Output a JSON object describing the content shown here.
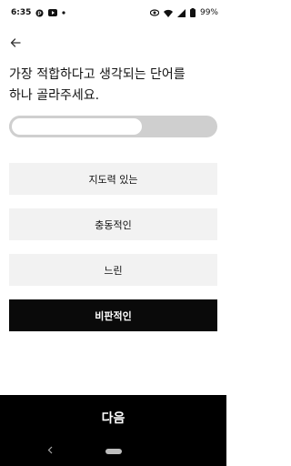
{
  "status_bar": {
    "time": "6:35",
    "battery": "99%",
    "left_icons": [
      "p-app-icon",
      "youtube-icon",
      "dot-icon"
    ],
    "right_icons": [
      "eye-icon",
      "wifi-icon",
      "signal-icon",
      "battery-icon"
    ]
  },
  "header": {
    "back_icon": "arrow-left-icon"
  },
  "question": {
    "line1": "가장 적합하다고 생각되는 단어를",
    "line2": "하나 골라주세요."
  },
  "progress": {
    "fraction": 0.65
  },
  "options": [
    {
      "label": "지도력 있는",
      "selected": false
    },
    {
      "label": "충동적인",
      "selected": false
    },
    {
      "label": "느린",
      "selected": false
    },
    {
      "label": "비판적인",
      "selected": true
    }
  ],
  "next_button": {
    "label": "다음"
  },
  "colors": {
    "selected_bg": "#0a0a0a",
    "option_bg": "#f2f2f2",
    "track": "#cfcfcf"
  }
}
